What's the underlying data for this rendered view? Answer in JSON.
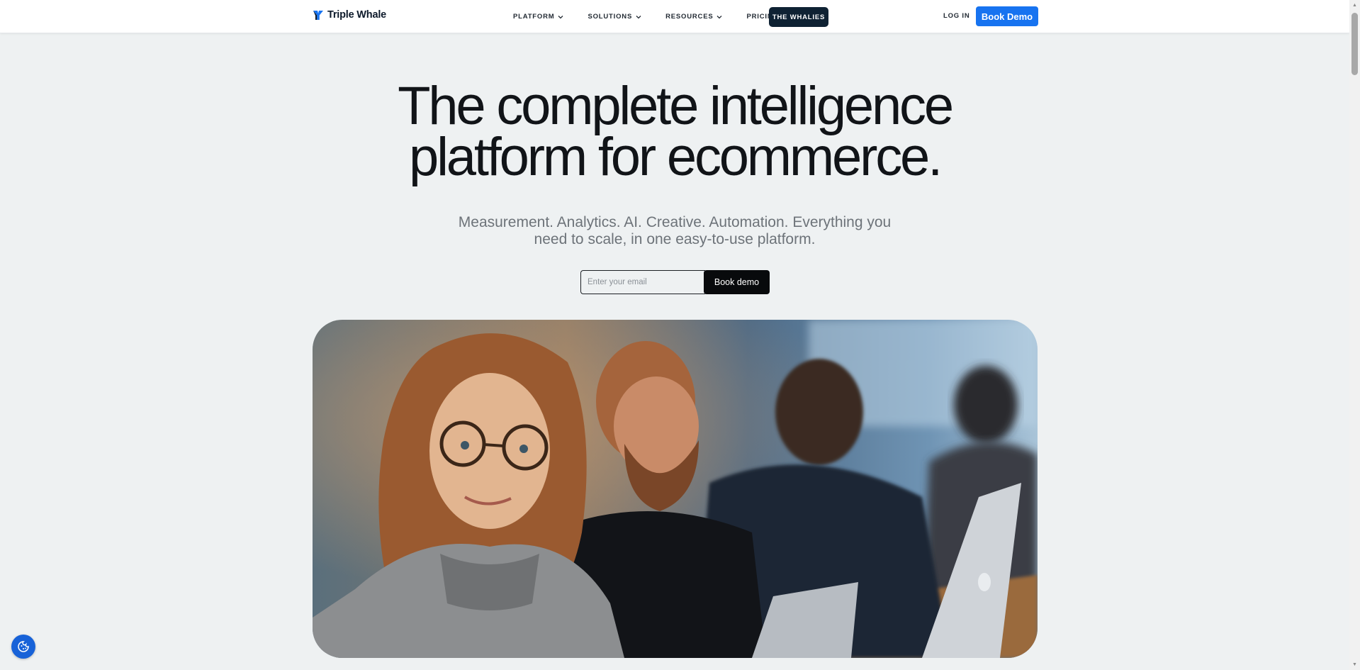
{
  "header": {
    "logo_text": "Triple Whale",
    "nav": [
      {
        "label": "PLATFORM",
        "has_dropdown": true
      },
      {
        "label": "SOLUTIONS",
        "has_dropdown": true
      },
      {
        "label": "RESOURCES",
        "has_dropdown": true
      },
      {
        "label": "PRICING",
        "has_dropdown": false
      }
    ],
    "highlight_label": "THE WHALIES",
    "login_label": "LOG IN",
    "cta_label": "Book Demo"
  },
  "hero": {
    "headline_line1": "The complete intelligence",
    "headline_line2": "platform for ecommerce.",
    "subhead_line1": "Measurement. Analytics. AI. Creative. Automation. Everything you",
    "subhead_line2": "need to scale, in one easy-to-use platform.",
    "email_placeholder": "Enter your email",
    "email_value": "",
    "submit_label": "Book demo",
    "image_icon": "team-photo"
  },
  "cookie": {
    "icon": "cookie-icon"
  },
  "colors": {
    "brand_blue": "#1773f0",
    "dark_pill": "#0f2233",
    "page_bg": "#eef1f2",
    "headline": "#111418",
    "subhead": "#6d7379"
  }
}
